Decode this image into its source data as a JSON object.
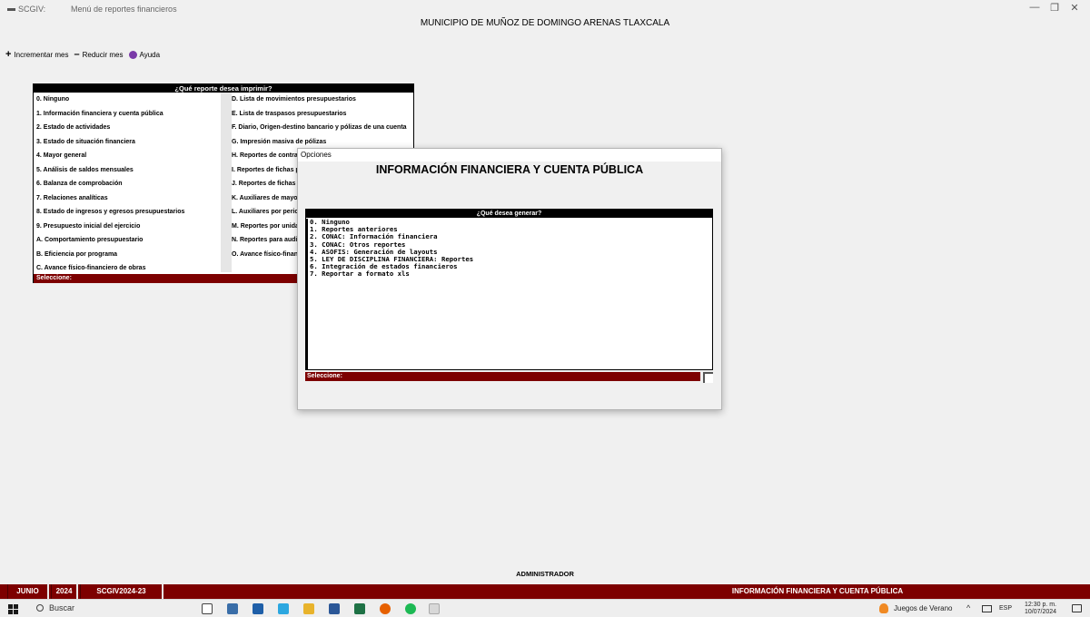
{
  "window": {
    "app_name": "SCGIV:",
    "title": "Menú de reportes financieros",
    "minimize": "—",
    "maximize": "❐",
    "close": "✕"
  },
  "municipio": "MUNICIPIO DE MUÑOZ DE DOMINGO ARENAS TLAXCALA",
  "toolbar": {
    "increment_label": "Incrementar mes",
    "decrement_label": "Reducir mes",
    "help_label": "Ayuda"
  },
  "report_menu": {
    "header": "¿Qué reporte desea imprimir?",
    "left_items": [
      "0. Ninguno",
      "1. Información financiera y cuenta pública",
      "2. Estado de actividades",
      "3. Estado de situación financiera",
      "4. Mayor general",
      "5. Análisis de saldos mensuales",
      "6. Balanza de comprobación",
      "7. Relaciones analíticas",
      "8. Estado de ingresos y egresos presupuestarios",
      "9. Presupuesto inicial del ejercicio",
      "A. Comportamiento presupuestario",
      "B. Eficiencia por programa",
      "C. Avance físico-financiero de obras"
    ],
    "right_items": [
      "D. Lista de movimientos presupuestarios",
      "E. Lista de traspasos presupuestarios",
      "F. Diario, Origen-destino bancario y pólizas de una cuenta",
      "G. Impresión masiva de pólizas",
      "H. Reportes de contra",
      "I. Reportes de fichas p",
      "J. Reportes de fichas",
      "K. Auxiliares de mayo",
      "L. Auxiliares por peric",
      "M. Reportes por unida",
      "N. Reportes para audit",
      "O. Avance físico-finan"
    ],
    "select_label": "Seleccione:"
  },
  "options_dialog": {
    "window_title": "Opciones",
    "heading": "INFORMACIÓN FINANCIERA Y CUENTA PÚBLICA",
    "panel_header": "¿Qué desea generar?",
    "items": [
      "0. Ninguno",
      "1. Reportes anteriores",
      "2. CONAC: Información financiera",
      "3. CONAC: Otros reportes",
      "4. ASOFIS: Generación de layouts",
      "5. LEY DE DISCIPLINA FINANCIERA: Reportes",
      "6. Integración de estados financieros",
      "7. Reportar a formato xls"
    ],
    "select_label": "Seleccione:"
  },
  "admin_label": "ADMINISTRADOR",
  "status_bar": {
    "month": "JUNIO",
    "year": "2024",
    "database": "SCGIV2024-23",
    "current_report": "INFORMACIÓN FINANCIERA Y CUENTA PÚBLICA"
  },
  "taskbar": {
    "search_label": "Buscar",
    "tray_app_label": "Juegos de Verano",
    "language": "ESP",
    "time": "12:30 p. m.",
    "date": "10/07/2024",
    "chevron": "^"
  },
  "colors": {
    "status_bar": "#7d0000",
    "header_black": "#000000",
    "background": "#f0f0f0"
  }
}
